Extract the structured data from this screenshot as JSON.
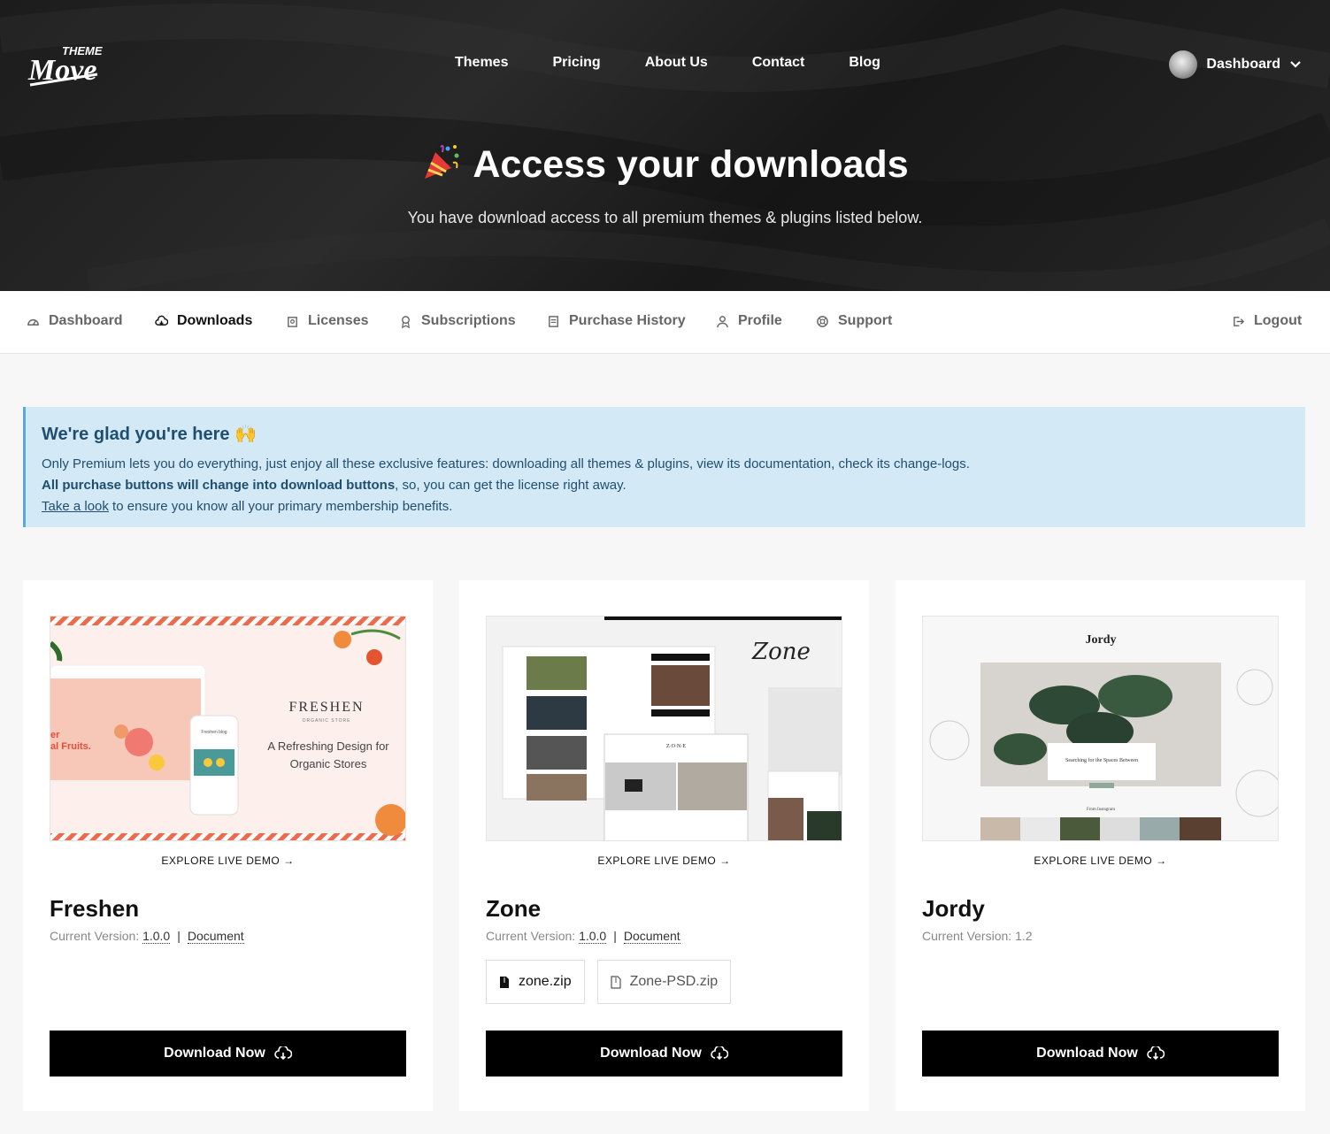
{
  "brand": {
    "logo_text_top": "THEME",
    "logo_text_main": "Move"
  },
  "topnav": {
    "items": [
      "Themes",
      "Pricing",
      "About Us",
      "Contact",
      "Blog"
    ]
  },
  "user": {
    "label": "Dashboard"
  },
  "hero": {
    "title": "Access your downloads",
    "subtitle": "You have download access to all premium themes & plugins listed below."
  },
  "subnav": {
    "items": [
      {
        "label": "Dashboard",
        "icon": "dashboard-icon"
      },
      {
        "label": "Downloads",
        "icon": "cloud-download-icon"
      },
      {
        "label": "Licenses",
        "icon": "license-icon"
      },
      {
        "label": "Subscriptions",
        "icon": "award-icon"
      },
      {
        "label": "Purchase History",
        "icon": "receipt-icon"
      },
      {
        "label": "Profile",
        "icon": "user-icon"
      },
      {
        "label": "Support",
        "icon": "lifebuoy-icon"
      }
    ],
    "logout": "Logout"
  },
  "alert": {
    "title": "We're glad you're here 🙌",
    "line1": "Only Premium lets you do everything, just enjoy all these exclusive features: downloading all themes & plugins, view its documentation, check its change-logs.",
    "line2_bold": "All purchase buttons will change into download buttons",
    "line2_rest": ", so, you can get the license right away.",
    "line3_link": "Take a look",
    "line3_rest": " to ensure you know all your primary membership benefits."
  },
  "cards": [
    {
      "name": "Freshen",
      "demo": "EXPLORE LIVE DEMO →",
      "version_label": "Current Version:",
      "version": "1.0.0",
      "doc": "Document",
      "button": "Download Now",
      "thumb": {
        "brand": "FRESHEN",
        "brand_sub": "ORGANIC STORE",
        "tagline1": "A Refreshing Design for",
        "tagline2": "Organic Stores",
        "left_text1": "er",
        "left_text2": "al Fruits.",
        "phone_title": "Freshen blog"
      }
    },
    {
      "name": "Zone",
      "demo": "EXPLORE LIVE DEMO →",
      "version_label": "Current Version:",
      "version": "1.0.0",
      "doc": "Document",
      "files": [
        "zone.zip",
        "Zone-PSD.zip"
      ],
      "button": "Download Now",
      "thumb": {
        "script": "Zone",
        "logo": "Z·O·N·E"
      }
    },
    {
      "name": "Jordy",
      "demo": "EXPLORE LIVE DEMO →",
      "version_label": "Current Version:",
      "version": "1.2",
      "button": "Download Now",
      "thumb": {
        "title": "Jordy",
        "caption": "Searching for the Spaces Between",
        "insta": "From Instagram"
      }
    }
  ],
  "colors": {
    "alert_bg": "#d4e9f6",
    "alert_text": "#1f4e70",
    "button_bg": "#000000"
  }
}
